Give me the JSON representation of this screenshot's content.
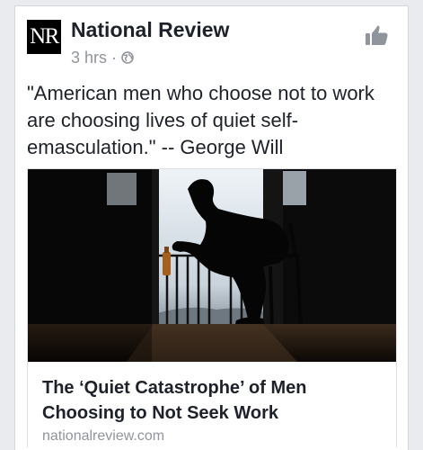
{
  "post": {
    "page_name": "National Review",
    "logo_text": "NR",
    "time": "3 hrs",
    "separator": "·",
    "privacy_icon": "globe-icon",
    "action_icon": "thumbs-up-icon",
    "status_text": "\"American men who choose not to work are choosing lives of quiet self-emasculation.\" -- George Will"
  },
  "link": {
    "image_icon": "photo-silhouette-man-on-chair",
    "title": "The ‘Quiet Catastrophe’ of Men Choosing to Not Seek Work",
    "domain": "nationalreview.com"
  },
  "colors": {
    "primary_text": "#1d2129",
    "secondary_text": "#90949c",
    "background": "#e9ebee",
    "card": "#ffffff"
  }
}
